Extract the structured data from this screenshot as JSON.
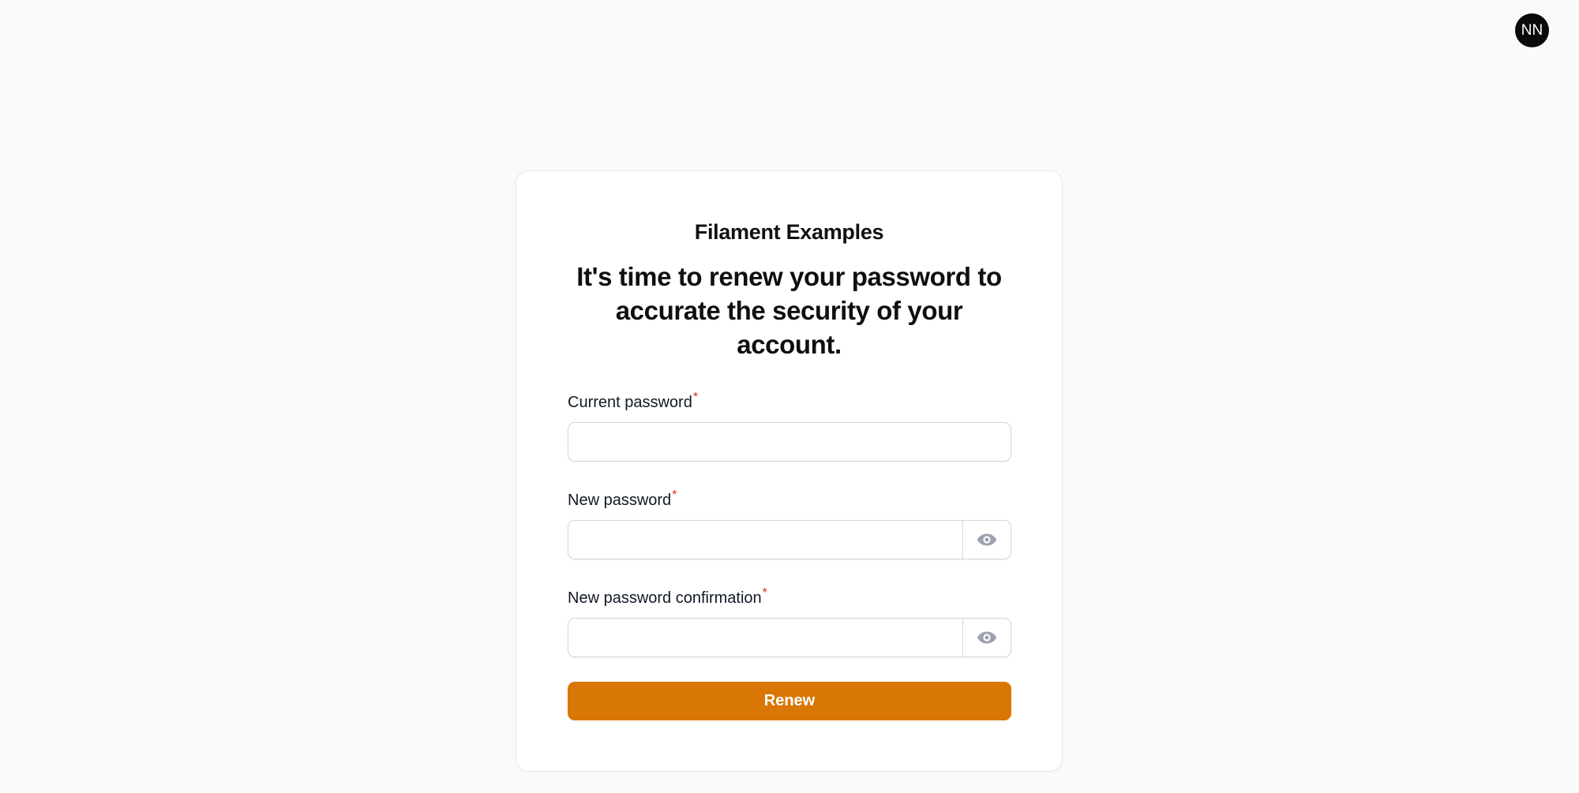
{
  "user": {
    "initials": "NN"
  },
  "card": {
    "brand": "Filament Examples",
    "heading": "It's time to renew your password to accurate the security of your account."
  },
  "form": {
    "current_password": {
      "label": "Current password",
      "required_mark": "*",
      "value": "",
      "placeholder": ""
    },
    "new_password": {
      "label": "New password",
      "required_mark": "*",
      "value": "",
      "placeholder": "",
      "toggle_icon": "eye-icon"
    },
    "new_password_confirmation": {
      "label": "New password confirmation",
      "required_mark": "*",
      "value": "",
      "placeholder": "",
      "toggle_icon": "eye-icon"
    },
    "submit_label": "Renew"
  },
  "colors": {
    "primary": "#d97706",
    "required": "#dc2626",
    "background": "#fafafa",
    "avatar_bg": "#0a0a0a",
    "icon_gray": "#9ca3af"
  }
}
